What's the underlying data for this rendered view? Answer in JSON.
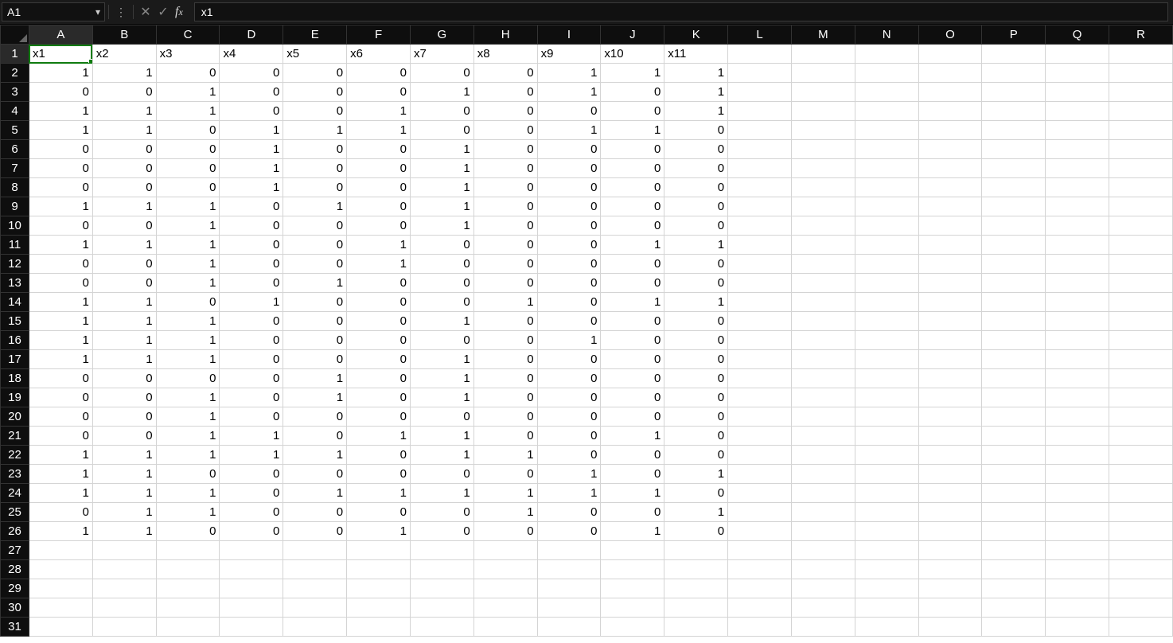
{
  "namebox": "A1",
  "formula": "x1",
  "columns": [
    "A",
    "B",
    "C",
    "D",
    "E",
    "F",
    "G",
    "H",
    "I",
    "J",
    "K",
    "L",
    "M",
    "N",
    "O",
    "P",
    "Q",
    "R"
  ],
  "totalRows": 31,
  "headers": [
    "x1",
    "x2",
    "x3",
    "x4",
    "x5",
    "x6",
    "x7",
    "x8",
    "x9",
    "x10",
    "x11"
  ],
  "selected": {
    "row": 1,
    "col": 0
  },
  "data": [
    [
      1,
      1,
      0,
      0,
      0,
      0,
      0,
      0,
      1,
      1,
      1
    ],
    [
      0,
      0,
      1,
      0,
      0,
      0,
      1,
      0,
      1,
      0,
      1
    ],
    [
      1,
      1,
      1,
      0,
      0,
      1,
      0,
      0,
      0,
      0,
      1
    ],
    [
      1,
      1,
      0,
      1,
      1,
      1,
      0,
      0,
      1,
      1,
      0
    ],
    [
      0,
      0,
      0,
      1,
      0,
      0,
      1,
      0,
      0,
      0,
      0
    ],
    [
      0,
      0,
      0,
      1,
      0,
      0,
      1,
      0,
      0,
      0,
      0
    ],
    [
      0,
      0,
      0,
      1,
      0,
      0,
      1,
      0,
      0,
      0,
      0
    ],
    [
      1,
      1,
      1,
      0,
      1,
      0,
      1,
      0,
      0,
      0,
      0
    ],
    [
      0,
      0,
      1,
      0,
      0,
      0,
      1,
      0,
      0,
      0,
      0
    ],
    [
      1,
      1,
      1,
      0,
      0,
      1,
      0,
      0,
      0,
      1,
      1
    ],
    [
      0,
      0,
      1,
      0,
      0,
      1,
      0,
      0,
      0,
      0,
      0
    ],
    [
      0,
      0,
      1,
      0,
      1,
      0,
      0,
      0,
      0,
      0,
      0
    ],
    [
      1,
      1,
      0,
      1,
      0,
      0,
      0,
      1,
      0,
      1,
      1
    ],
    [
      1,
      1,
      1,
      0,
      0,
      0,
      1,
      0,
      0,
      0,
      0
    ],
    [
      1,
      1,
      1,
      0,
      0,
      0,
      0,
      0,
      1,
      0,
      0
    ],
    [
      1,
      1,
      1,
      0,
      0,
      0,
      1,
      0,
      0,
      0,
      0
    ],
    [
      0,
      0,
      0,
      0,
      1,
      0,
      1,
      0,
      0,
      0,
      0
    ],
    [
      0,
      0,
      1,
      0,
      1,
      0,
      1,
      0,
      0,
      0,
      0
    ],
    [
      0,
      0,
      1,
      0,
      0,
      0,
      0,
      0,
      0,
      0,
      0
    ],
    [
      0,
      0,
      1,
      1,
      0,
      1,
      1,
      0,
      0,
      1,
      0
    ],
    [
      1,
      1,
      1,
      1,
      1,
      0,
      1,
      1,
      0,
      0,
      0
    ],
    [
      1,
      1,
      0,
      0,
      0,
      0,
      0,
      0,
      1,
      0,
      1
    ],
    [
      1,
      1,
      1,
      0,
      1,
      1,
      1,
      1,
      1,
      1,
      0
    ],
    [
      0,
      1,
      1,
      0,
      0,
      0,
      0,
      1,
      0,
      0,
      1
    ],
    [
      1,
      1,
      0,
      0,
      0,
      1,
      0,
      0,
      0,
      1,
      0
    ]
  ]
}
